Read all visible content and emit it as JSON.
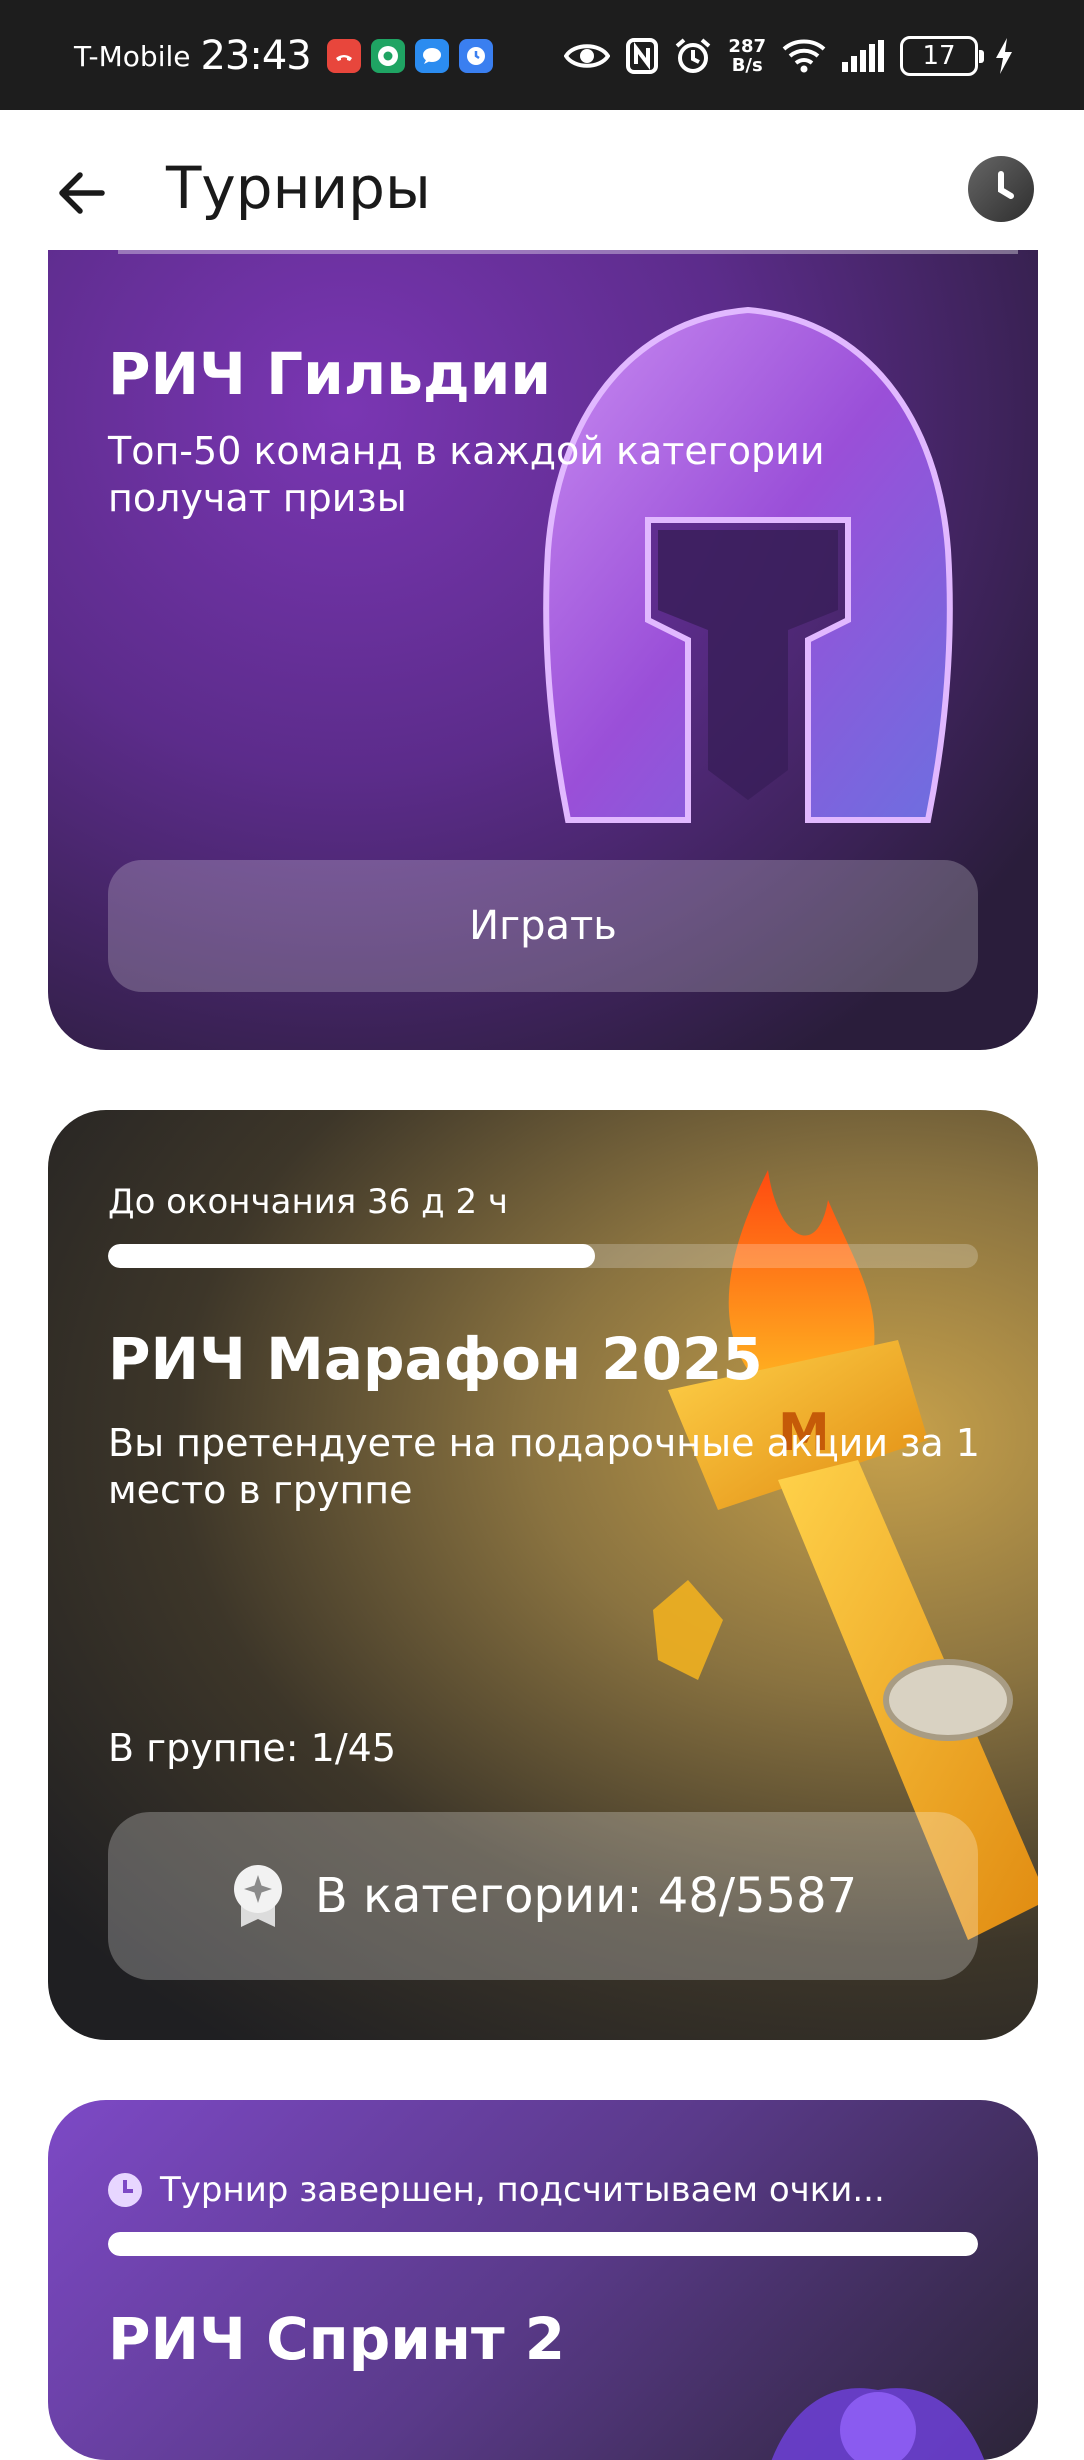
{
  "status_bar": {
    "carrier": "T-Mobile",
    "time": "23:43",
    "net_speed_value": "287",
    "net_speed_unit": "B/s",
    "battery": "17",
    "app_icons": [
      "missed-call-icon",
      "chrome-app-icon",
      "messages-app-icon",
      "clock-app-icon"
    ],
    "right_icons": [
      "eye-icon",
      "nfc-icon",
      "alarm-icon",
      "wifi-icon",
      "signal-icon",
      "charging-icon"
    ]
  },
  "header": {
    "title": "Турниры",
    "back_icon": "arrow-left-icon",
    "history_icon": "clock-icon"
  },
  "cards": [
    {
      "title": "РИЧ Гильдии",
      "description": "Топ-50 команд в каждой категории получат призы",
      "button_label": "Играть",
      "illustration": "spartan-helmet-icon"
    },
    {
      "deadline": "До окончания 36 д 2 ч",
      "progress": 0.56,
      "title": "РИЧ Марафон 2025",
      "description": "Вы претендуете на подарочные акции за 1 место в группе",
      "group_rank": "В группе: 1/45",
      "category_rank": "В категории: 48/5587",
      "illustration": "torch-icon"
    },
    {
      "status": "Турнир завершен, подсчитываем очки...",
      "progress": 1.0,
      "title": "РИЧ Спринт 2"
    }
  ],
  "colors": {
    "status_bar_bg": "#1d1d1d",
    "guild_card_bg": "#5c2c8b",
    "marathon_card_bg": "#3d3629",
    "sprint_card_bg": "#7d49c6",
    "text_on_card": "#ffffff"
  }
}
